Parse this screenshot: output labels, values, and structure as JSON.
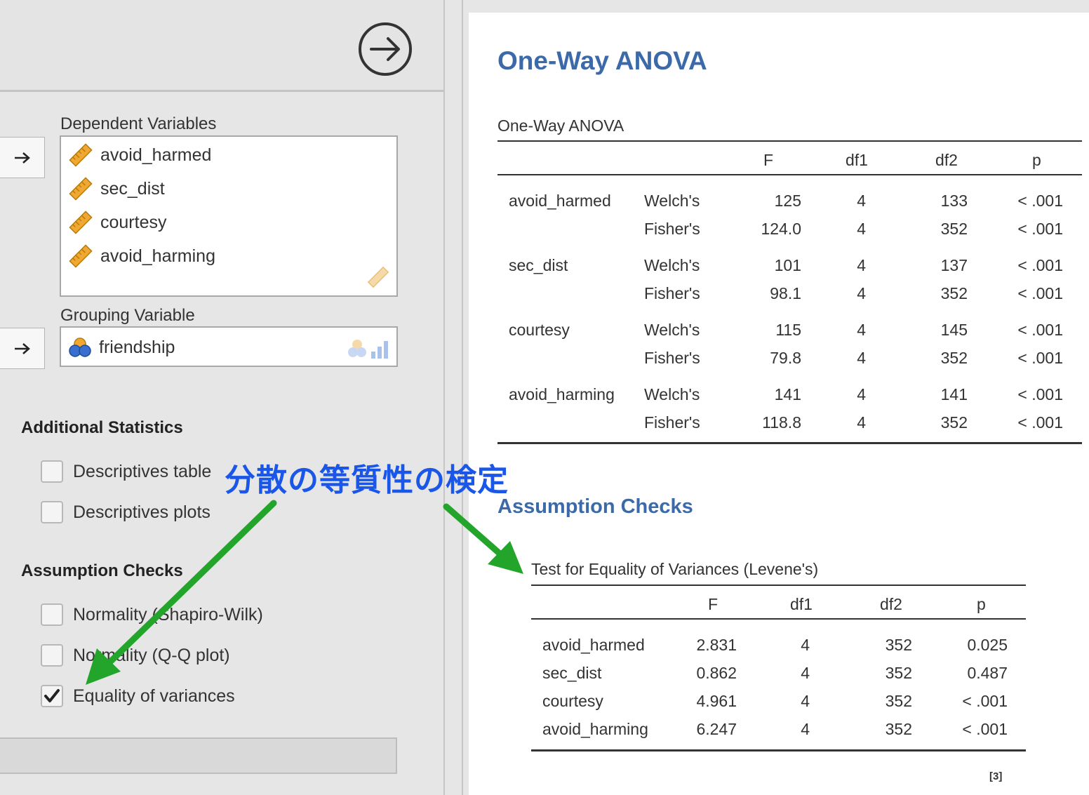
{
  "options": {
    "dependent_label": "Dependent Variables",
    "dependent_vars": [
      "avoid_harmed",
      "sec_dist",
      "courtesy",
      "avoid_harming"
    ],
    "grouping_label": "Grouping Variable",
    "grouping_var": "friendship",
    "additional_title": "Additional Statistics",
    "additional": [
      {
        "label": "Descriptives table",
        "checked": false
      },
      {
        "label": "Descriptives plots",
        "checked": false
      }
    ],
    "assumption_title": "Assumption Checks",
    "assumption": [
      {
        "label": "Normality (Shapiro-Wilk)",
        "checked": false
      },
      {
        "label": "Normality (Q-Q plot)",
        "checked": false
      },
      {
        "label": "Equality of variances",
        "checked": true
      }
    ]
  },
  "results": {
    "heading": "One-Way ANOVA",
    "anova_table": {
      "title": "One-Way ANOVA",
      "headers": [
        "F",
        "df1",
        "df2",
        "p"
      ],
      "rows": [
        {
          "var": "avoid_harmed",
          "test": "Welch's",
          "F": "125",
          "df1": "4",
          "df2": "133",
          "p": "< .001"
        },
        {
          "var": "",
          "test": "Fisher's",
          "F": "124.0",
          "df1": "4",
          "df2": "352",
          "p": "< .001"
        },
        {
          "var": "sec_dist",
          "test": "Welch's",
          "F": "101",
          "df1": "4",
          "df2": "137",
          "p": "< .001"
        },
        {
          "var": "",
          "test": "Fisher's",
          "F": "98.1",
          "df1": "4",
          "df2": "352",
          "p": "< .001"
        },
        {
          "var": "courtesy",
          "test": "Welch's",
          "F": "115",
          "df1": "4",
          "df2": "145",
          "p": "< .001"
        },
        {
          "var": "",
          "test": "Fisher's",
          "F": "79.8",
          "df1": "4",
          "df2": "352",
          "p": "< .001"
        },
        {
          "var": "avoid_harming",
          "test": "Welch's",
          "F": "141",
          "df1": "4",
          "df2": "141",
          "p": "< .001"
        },
        {
          "var": "",
          "test": "Fisher's",
          "F": "118.8",
          "df1": "4",
          "df2": "352",
          "p": "< .001"
        }
      ]
    },
    "assumption_heading": "Assumption Checks",
    "levene_table": {
      "title": "Test for Equality of Variances (Levene's)",
      "headers": [
        "F",
        "df1",
        "df2",
        "p"
      ],
      "rows": [
        {
          "var": "avoid_harmed",
          "F": "2.831",
          "df1": "4",
          "df2": "352",
          "p": "0.025"
        },
        {
          "var": "sec_dist",
          "F": "0.862",
          "df1": "4",
          "df2": "352",
          "p": "0.487"
        },
        {
          "var": "courtesy",
          "F": "4.961",
          "df1": "4",
          "df2": "352",
          "p": "< .001"
        },
        {
          "var": "avoid_harming",
          "F": "6.247",
          "df1": "4",
          "df2": "352",
          "p": "< .001"
        }
      ]
    },
    "footnote_ref": "[3]"
  },
  "annotation": {
    "text": "分散の等質性の検定",
    "text_color": "#1a56e8",
    "arrow_color": "#22a52a"
  },
  "colors": {
    "heading": "#3c6aa8",
    "ruler_icon": "#f0a830",
    "nominal_icon": "#3a6fcf"
  }
}
